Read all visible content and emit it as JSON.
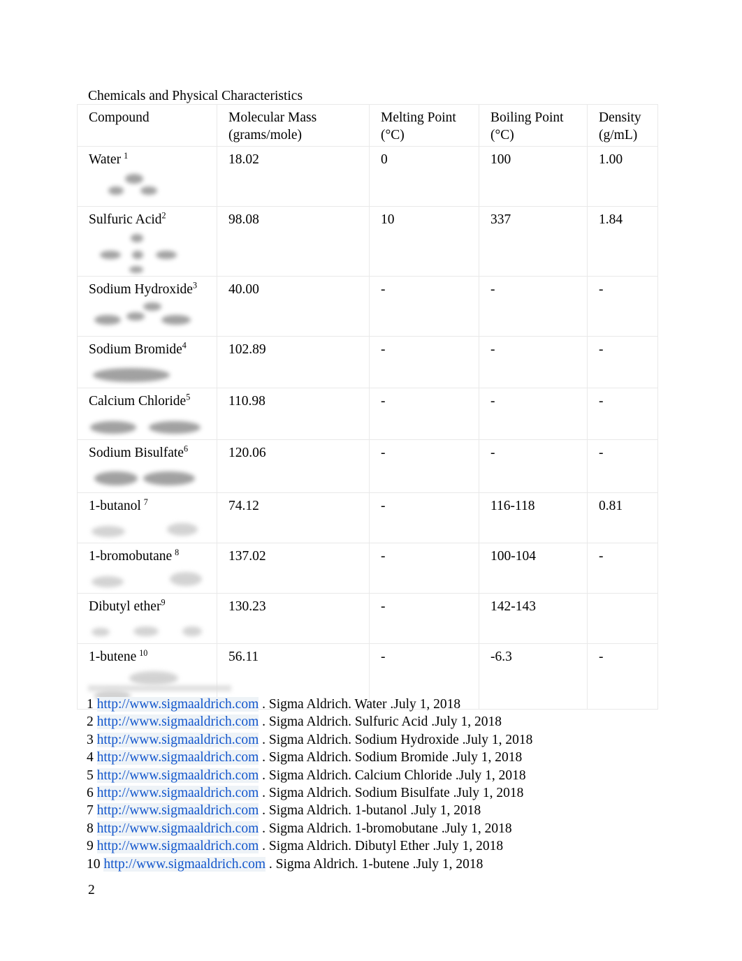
{
  "document": {
    "title": "Chemicals and Physical Characteristics",
    "page_number": "2"
  },
  "table": {
    "columns": [
      {
        "key": "compound",
        "header_line1": "Compound",
        "header_line2": ""
      },
      {
        "key": "mass",
        "header_line1": "Molecular Mass",
        "header_line2": "(grams/mole)"
      },
      {
        "key": "mp",
        "header_line1": "Melting Point",
        "header_line2": "(°C)"
      },
      {
        "key": "bp",
        "header_line1": "Boiling Point",
        "header_line2": "(°C)"
      },
      {
        "key": "density",
        "header_line1": "Density",
        "header_line2": "(g/mL)"
      }
    ],
    "rows": [
      {
        "compound": "Water",
        "footnote": "1",
        "mass": "18.02",
        "mp": "0",
        "bp": "100",
        "density": "1.00"
      },
      {
        "compound": "Sulfuric Acid",
        "footnote": "2",
        "mass": "98.08",
        "mp": "10",
        "bp": "337",
        "density": "1.84"
      },
      {
        "compound": "Sodium Hydroxide",
        "footnote": "3",
        "mass": "40.00",
        "mp": "-",
        "bp": "-",
        "density": "-"
      },
      {
        "compound": "Sodium Bromide",
        "footnote": "4",
        "mass": "102.89",
        "mp": "-",
        "bp": "-",
        "density": "-"
      },
      {
        "compound": "Calcium Chloride",
        "footnote": "5",
        "mass": "110.98",
        "mp": "-",
        "bp": "-",
        "density": "-"
      },
      {
        "compound": "Sodium Bisulfate",
        "footnote": "6",
        "mass": "120.06",
        "mp": "-",
        "bp": "-",
        "density": "-"
      },
      {
        "compound": "1-butanol",
        "footnote": "7",
        "mass": "74.12",
        "mp": "-",
        "bp": "116-118",
        "density": "0.81"
      },
      {
        "compound": "1-bromobutane",
        "footnote": "8",
        "mass": "137.02",
        "mp": "-",
        "bp": "100-104",
        "density": "-"
      },
      {
        "compound": "Dibutyl ether",
        "footnote": "9",
        "mass": "130.23",
        "mp": "-",
        "bp": "142-143",
        "density": ""
      },
      {
        "compound": "1-butene",
        "footnote": "10",
        "mass": "56.11",
        "mp": "-",
        "bp": "-6.3",
        "density": "-"
      }
    ]
  },
  "citations": [
    {
      "number": "1",
      "url": "http://www.sigmaaldrich.com",
      "rest": ". Sigma Aldrich. Water .July 1, 2018"
    },
    {
      "number": "2",
      "url": "http://www.sigmaaldrich.com",
      "rest": ". Sigma Aldrich. Sulfuric Acid .July 1, 2018"
    },
    {
      "number": "3",
      "url": "http://www.sigmaaldrich.com",
      "rest": ". Sigma Aldrich. Sodium Hydroxide .July 1, 2018"
    },
    {
      "number": "4",
      "url": "http://www.sigmaaldrich.com",
      "rest": ". Sigma Aldrich. Sodium Bromide .July 1, 2018"
    },
    {
      "number": "5",
      "url": "http://www.sigmaaldrich.com",
      "rest": ". Sigma Aldrich. Calcium Chloride .July 1, 2018"
    },
    {
      "number": "6",
      "url": "http://www.sigmaaldrich.com",
      "rest": ". Sigma Aldrich. Sodium Bisulfate .July 1, 2018"
    },
    {
      "number": "7",
      "url": "http://www.sigmaaldrich.com",
      "rest": ". Sigma Aldrich. 1-butanol .July 1, 2018"
    },
    {
      "number": "8",
      "url": "http://www.sigmaaldrich.com",
      "rest": ". Sigma Aldrich. 1-bromobutane .July 1, 2018"
    },
    {
      "number": "9",
      "url": "http://www.sigmaaldrich.com",
      "rest": ". Sigma Aldrich. Dibutyl Ether .July 1, 2018"
    },
    {
      "number": "10",
      "url": "http://www.sigmaaldrich.com",
      "rest": ". Sigma Aldrich. 1-butene .July 1, 2018"
    }
  ],
  "colors": {
    "link": "#1155cc",
    "border": "#e9e9e9",
    "text": "#000000"
  }
}
